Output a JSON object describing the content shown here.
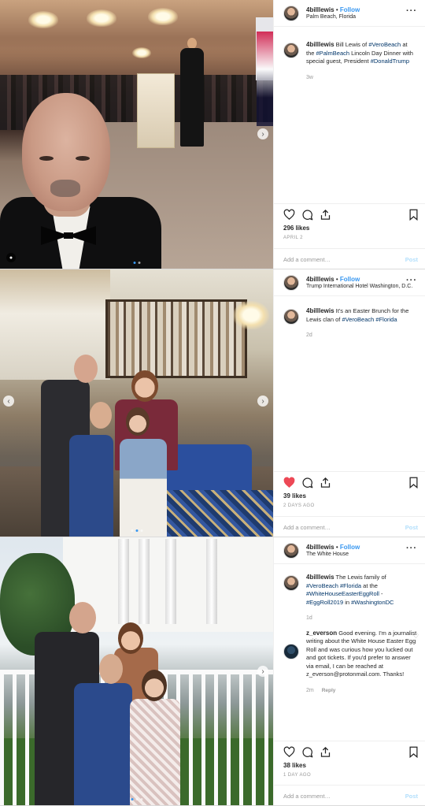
{
  "posts": [
    {
      "author": "4billlewis",
      "follow_label": "Follow",
      "location": "Palm Beach, Florida",
      "caption_author": "4billlewis",
      "caption": [
        {
          "t": "Bill Lewis of ",
          "tag": false
        },
        {
          "t": "#VeroBeach",
          "tag": true
        },
        {
          "t": " at the ",
          "tag": false
        },
        {
          "t": "#PalmBeach",
          "tag": true
        },
        {
          "t": " Lincoln Day Dinner with special guest, President ",
          "tag": false
        },
        {
          "t": "#DonaldTrump",
          "tag": true
        }
      ],
      "caption_time": "3w",
      "likes": "296 likes",
      "date": "APRIL 2",
      "liked": false,
      "add_comment_placeholder": "Add a comment…",
      "post_label": "Post"
    },
    {
      "author": "4billlewis",
      "follow_label": "Follow",
      "location": "Trump International Hotel Washington, D.C.",
      "caption_author": "4billlewis",
      "caption": [
        {
          "t": "It's an Easter Brunch for the Lewis clan of ",
          "tag": false
        },
        {
          "t": "#VeroBeach",
          "tag": true
        },
        {
          "t": " ",
          "tag": false
        },
        {
          "t": "#Florida",
          "tag": true
        }
      ],
      "caption_time": "2d",
      "likes": "39 likes",
      "date": "2 DAYS AGO",
      "liked": true,
      "add_comment_placeholder": "Add a comment…",
      "post_label": "Post"
    },
    {
      "author": "4billlewis",
      "follow_label": "Follow",
      "location": "The White House",
      "caption_author": "4billlewis",
      "caption": [
        {
          "t": "The Lewis family of ",
          "tag": false
        },
        {
          "t": "#VeroBeach",
          "tag": true
        },
        {
          "t": " ",
          "tag": false
        },
        {
          "t": "#Florida",
          "tag": true
        },
        {
          "t": " at the ",
          "tag": false
        },
        {
          "t": "#WhiteHouseEasterEggRoll",
          "tag": true
        },
        {
          "t": " - ",
          "tag": false
        },
        {
          "t": "#EggRoll2019",
          "tag": true
        },
        {
          "t": " in ",
          "tag": false
        },
        {
          "t": "#WashingtonDC",
          "tag": true
        }
      ],
      "caption_time": "1d",
      "reply_comment": {
        "author": "z_everson",
        "text": "Good evening. I'm a journalist writing about the White House Easter Egg Roll and was curious how you lucked out and got tickets. If you'd prefer to answer via email, I can be reached at z_everson@protonmail.com. Thanks!",
        "time": "2m",
        "reply_label": "Reply"
      },
      "likes": "38 likes",
      "date": "1 DAY AGO",
      "liked": false,
      "add_comment_placeholder": "Add a comment…",
      "post_label": "Post"
    }
  ],
  "colors": {
    "link_blue": "#3897f0",
    "hashtag": "#003569",
    "liked_heart": "#ed4956",
    "muted": "#999999"
  },
  "icons": {
    "like": "heart-icon",
    "comment": "comment-bubble-icon",
    "share": "share-icon",
    "save": "bookmark-icon",
    "more": "more-options-icon"
  }
}
